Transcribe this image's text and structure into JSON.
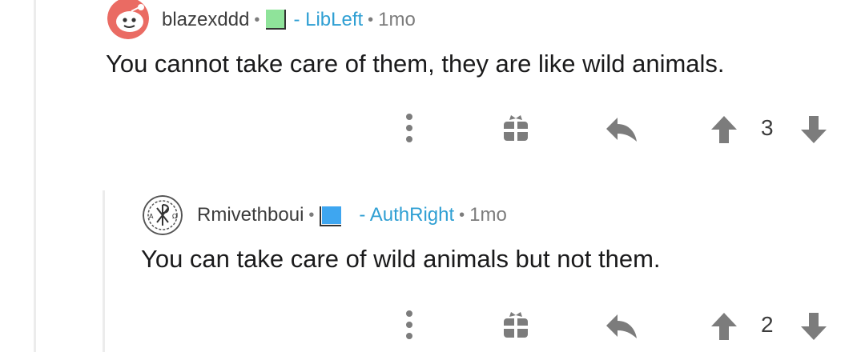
{
  "comments": [
    {
      "username": "blazexddd",
      "flair_label": "- LibLeft",
      "flair_color": "#8fe39a",
      "age": "1mo",
      "body": "You cannot take care of them, they are like wild animals.",
      "score": "3",
      "avatar": "snoo-avatar"
    },
    {
      "username": "Rmivethboui",
      "flair_label": "- AuthRight",
      "flair_color": "#3ea6f0",
      "age": "1mo",
      "body": "You can take care of wild animals but not them.",
      "score": "2",
      "avatar": "chi-rho-wreath-avatar"
    }
  ],
  "separator": "•",
  "icons": {
    "more": "more-vertical-icon",
    "award": "gift-icon",
    "reply": "reply-arrow-icon",
    "upvote": "upvote-arrow-icon",
    "downvote": "downvote-arrow-icon"
  },
  "colors": {
    "link_blue": "#2f9fd3",
    "icon_gray": "#7c7c7c",
    "text": "#1a1a1b"
  }
}
